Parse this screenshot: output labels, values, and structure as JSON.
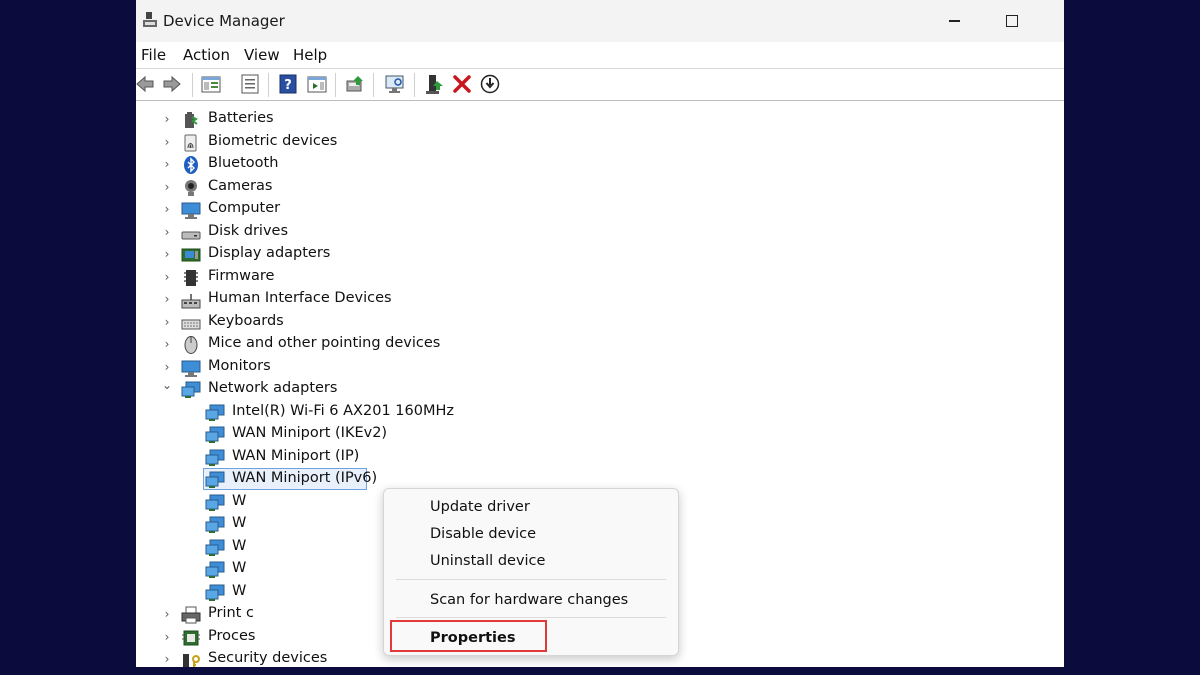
{
  "window": {
    "title": "Device Manager"
  },
  "menubar": [
    "File",
    "Action",
    "View",
    "Help"
  ],
  "toolbar": [
    "back-icon",
    "forward-icon",
    "show-hide-console-tree-icon",
    "properties-icon",
    "help-icon",
    "action-pane-icon",
    "update-driver-icon",
    "scan-hardware-icon",
    "enable-device-icon",
    "uninstall-device-icon",
    "disable-device-icon"
  ],
  "tree": {
    "categories": [
      {
        "label": "Batteries",
        "icon": "battery-icon",
        "expanded": false
      },
      {
        "label": "Biometric devices",
        "icon": "fingerprint-icon",
        "expanded": false
      },
      {
        "label": "Bluetooth",
        "icon": "bluetooth-icon",
        "expanded": false
      },
      {
        "label": "Cameras",
        "icon": "camera-icon",
        "expanded": false
      },
      {
        "label": "Computer",
        "icon": "computer-icon",
        "expanded": false
      },
      {
        "label": "Disk drives",
        "icon": "disk-drive-icon",
        "expanded": false
      },
      {
        "label": "Display adapters",
        "icon": "display-adapter-icon",
        "expanded": false
      },
      {
        "label": "Firmware",
        "icon": "firmware-icon",
        "expanded": false
      },
      {
        "label": "Human Interface Devices",
        "icon": "hid-icon",
        "expanded": false
      },
      {
        "label": "Keyboards",
        "icon": "keyboard-icon",
        "expanded": false
      },
      {
        "label": "Mice and other pointing devices",
        "icon": "mouse-icon",
        "expanded": false
      },
      {
        "label": "Monitors",
        "icon": "monitor-icon",
        "expanded": false
      },
      {
        "label": "Network adapters",
        "icon": "network-adapter-icon",
        "expanded": true
      }
    ],
    "network_children": [
      {
        "label": "Intel(R) Wi-Fi 6 AX201 160MHz",
        "selected": false
      },
      {
        "label": "WAN Miniport (IKEv2)",
        "selected": false
      },
      {
        "label": "WAN Miniport (IP)",
        "selected": false
      },
      {
        "label": "WAN Miniport (IPv6)",
        "selected": true
      },
      {
        "label": "W",
        "selected": false
      },
      {
        "label": "W",
        "selected": false
      },
      {
        "label": "W",
        "selected": false
      },
      {
        "label": "W",
        "selected": false
      },
      {
        "label": "W",
        "selected": false
      }
    ],
    "after": [
      {
        "label": "Print c",
        "icon": "printer-icon",
        "expanded": false
      },
      {
        "label": "Proces",
        "icon": "processor-icon",
        "expanded": false
      },
      {
        "label": "Security devices",
        "icon": "security-device-icon",
        "expanded": false
      }
    ]
  },
  "context_menu": {
    "update_driver": "Update driver",
    "disable_device": "Disable device",
    "uninstall_device": "Uninstall device",
    "scan_hardware": "Scan for hardware changes",
    "properties": "Properties",
    "highlight_color": "#e03a3a"
  }
}
